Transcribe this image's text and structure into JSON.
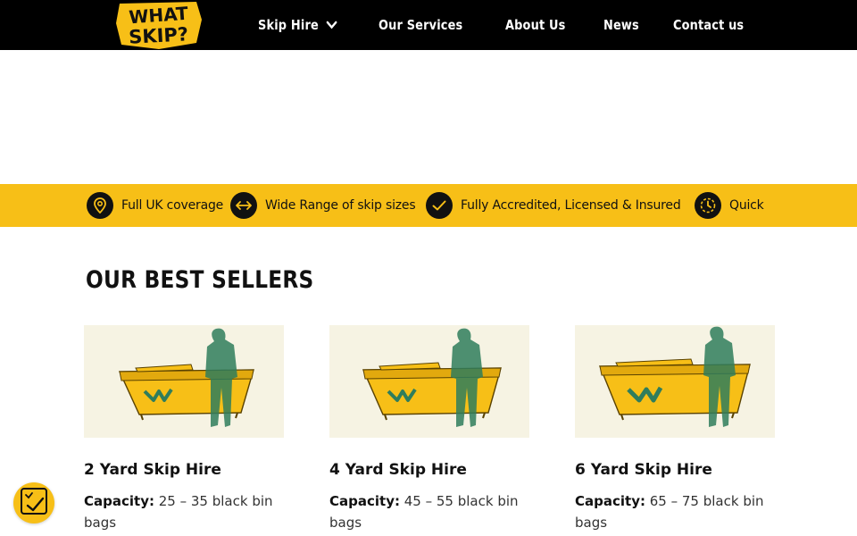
{
  "logo": {
    "text_line1": "WHAT",
    "text_line2": "SKIP?"
  },
  "nav": {
    "items": [
      {
        "label": "Skip Hire",
        "has_dropdown": true
      },
      {
        "label": "Our Services"
      },
      {
        "label": "About Us"
      },
      {
        "label": "News"
      },
      {
        "label": "Contact us"
      }
    ]
  },
  "features": [
    {
      "label": "Full UK coverage",
      "icon": "map-pin-icon"
    },
    {
      "label": "Wide Range of skip sizes",
      "icon": "arrows-horizontal-icon"
    },
    {
      "label": "Fully Accredited, Licensed & Insured",
      "icon": "checkmark-icon"
    },
    {
      "label": "Quick",
      "icon": "clock-icon"
    }
  ],
  "best_sellers": {
    "heading": "OUR BEST SELLERS",
    "cards": [
      {
        "title": "2 Yard Skip Hire",
        "capacity_label": "Capacity:",
        "capacity_value": "25 – 35 black bin bags"
      },
      {
        "title": "4 Yard Skip Hire",
        "capacity_label": "Capacity:",
        "capacity_value": "45 – 55 black bin bags"
      },
      {
        "title": "6 Yard Skip Hire",
        "capacity_label": "Capacity:",
        "capacity_value": "65 – 75 black bin bags"
      }
    ]
  },
  "colors": {
    "accent": "#f7bf17",
    "dark": "#000000",
    "skip_green": "#2f7d5c"
  }
}
